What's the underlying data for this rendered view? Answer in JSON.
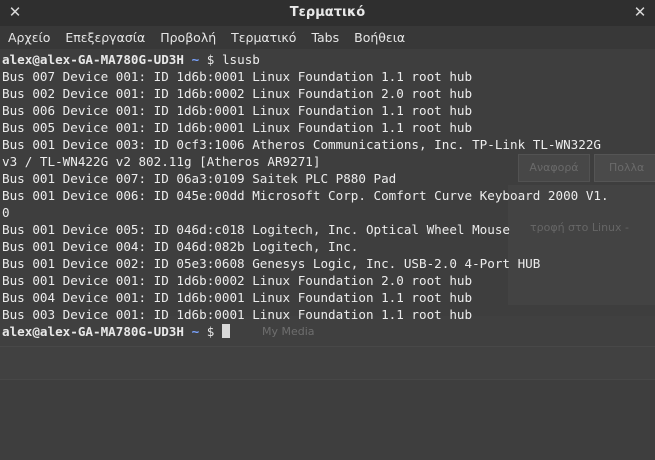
{
  "window": {
    "title": "Τερματικό",
    "minimize_glyph": "✕",
    "close_glyph": "✕"
  },
  "menu": {
    "items": [
      "Αρχείο",
      "Επεξεργασία",
      "Προβολή",
      "Τερματικό",
      "Tabs",
      "Βοήθεια"
    ]
  },
  "terminal": {
    "prompt_user_host": "alex@alex-GA-MA780G-UD3H",
    "prompt_path": "~",
    "prompt_symbol": "$",
    "command": "lsusb",
    "output": [
      "Bus 007 Device 001: ID 1d6b:0001 Linux Foundation 1.1 root hub",
      "Bus 002 Device 001: ID 1d6b:0002 Linux Foundation 2.0 root hub",
      "Bus 006 Device 001: ID 1d6b:0001 Linux Foundation 1.1 root hub",
      "Bus 005 Device 001: ID 1d6b:0001 Linux Foundation 1.1 root hub",
      "Bus 001 Device 003: ID 0cf3:1006 Atheros Communications, Inc. TP-Link TL-WN322G",
      "v3 / TL-WN422G v2 802.11g [Atheros AR9271]",
      "Bus 001 Device 007: ID 06a3:0109 Saitek PLC P880 Pad",
      "Bus 001 Device 006: ID 045e:00dd Microsoft Corp. Comfort Curve Keyboard 2000 V1.",
      "0",
      "Bus 001 Device 005: ID 046d:c018 Logitech, Inc. Optical Wheel Mouse",
      "Bus 001 Device 004: ID 046d:082b Logitech, Inc.",
      "Bus 001 Device 002: ID 05e3:0608 Genesys Logic, Inc. USB-2.0 4-Port HUB",
      "Bus 001 Device 001: ID 1d6b:0002 Linux Foundation 2.0 root hub",
      "Bus 004 Device 001: ID 1d6b:0001 Linux Foundation 1.1 root hub",
      "Bus 003 Device 001: ID 1d6b:0001 Linux Foundation 1.1 root hub"
    ]
  },
  "background_ghost": {
    "tab1_label": "Αναφορά",
    "tab2_label": "Πολλα",
    "panel_text": "τροφή στο Linux -",
    "toolbar_media_label": "My Media"
  },
  "colors": {
    "terminal_bg": "#3e3e3e",
    "text": "#ececec",
    "prompt_path": "#7aa3ff",
    "titlebar_bg": "#2f2f2f",
    "menubar_bg": "#383838"
  }
}
